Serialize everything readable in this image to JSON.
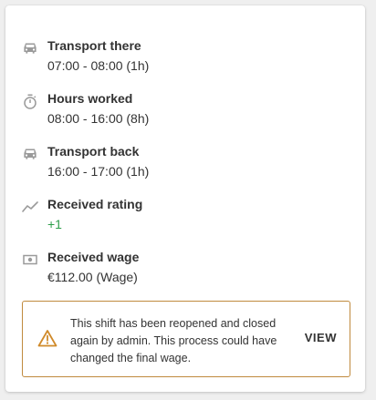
{
  "rows": [
    {
      "icon": "car-icon",
      "title": "Transport there",
      "value": "07:00 - 08:00 (1h)"
    },
    {
      "icon": "stopwatch-icon",
      "title": "Hours worked",
      "value": "08:00 - 16:00 (8h)"
    },
    {
      "icon": "car-icon",
      "title": "Transport back",
      "value": "16:00 - 17:00 (1h)"
    },
    {
      "icon": "trend-icon",
      "title": "Received rating",
      "value": "+1"
    },
    {
      "icon": "banknote-icon",
      "title": "Received wage",
      "value": "€112.00 (Wage)"
    }
  ],
  "warning": {
    "icon": "warning-triangle-icon",
    "message": "This shift has been reopened and closed again by admin. This process could have changed the final wage.",
    "action_label": "VIEW"
  },
  "colors": {
    "text": "#333333",
    "icon": "#9a9a9a",
    "positive": "#2e9e4a",
    "warning_border": "#c08a3e",
    "warning_icon": "#d08a2a"
  }
}
